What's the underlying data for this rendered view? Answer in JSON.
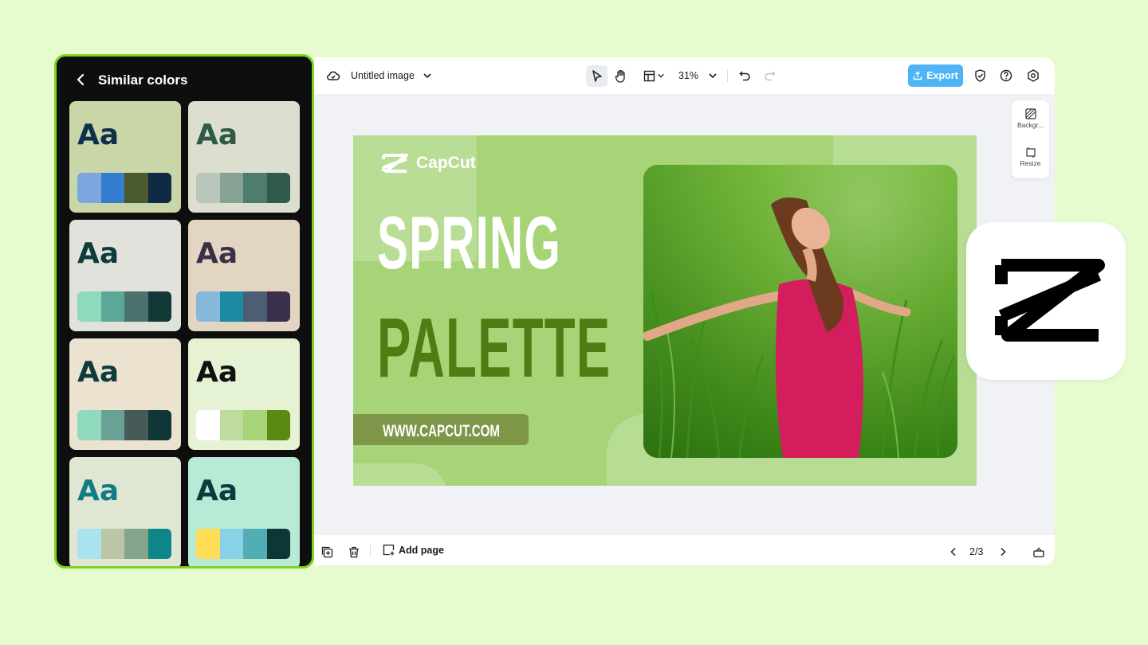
{
  "panel": {
    "title": "Similar colors",
    "cards": [
      {
        "sample": "Aa",
        "bg": "#c9d6a8",
        "text_color": "#0f2f4a",
        "swatches": [
          "#7ba6e0",
          "#357dcf",
          "#4b5a2e",
          "#0f2a44"
        ]
      },
      {
        "sample": "Aa",
        "bg": "#dcdfcf",
        "text_color": "#2f5a4a",
        "swatches": [
          "#b8c5bb",
          "#86a295",
          "#4d7d6b",
          "#2f5a4c"
        ]
      },
      {
        "sample": "Aa",
        "bg": "#e2e2dc",
        "text_color": "#0e3b3b",
        "swatches": [
          "#8fd9bd",
          "#5ca797",
          "#4c726d",
          "#123838"
        ]
      },
      {
        "sample": "Aa",
        "bg": "#e2d6c2",
        "text_color": "#3a3147",
        "swatches": [
          "#86b8d9",
          "#1b8aa3",
          "#4b5e74",
          "#3b3049"
        ]
      },
      {
        "sample": "Aa",
        "bg": "#ebe2cf",
        "text_color": "#0e3b3b",
        "swatches": [
          "#8fd9bd",
          "#6aa197",
          "#465a58",
          "#0e3636"
        ]
      },
      {
        "sample": "Aa",
        "bg": "#e6f2d4",
        "text_color": "#111111",
        "swatches": [
          "#ffffff",
          "#bfdc9f",
          "#a6d477",
          "#5a8a12"
        ]
      },
      {
        "sample": "Aa",
        "bg": "#dfe7d3",
        "text_color": "#0e7d86",
        "swatches": [
          "#a9e3ef",
          "#bcc6a7",
          "#85a58a",
          "#0e8589"
        ]
      },
      {
        "sample": "Aa",
        "bg": "#b8ead6",
        "text_color": "#0e3b3b",
        "swatches": [
          "#ffdd57",
          "#88d1e6",
          "#52aeb3",
          "#0e3636"
        ]
      }
    ]
  },
  "topbar": {
    "doc_title": "Untitled image",
    "zoom": "31%",
    "export_label": "Export"
  },
  "side_tools": {
    "background_label": "Backgr...",
    "resize_label": "Resize"
  },
  "bottombar": {
    "add_page_label": "Add page",
    "page_count": "2/3"
  },
  "design": {
    "brand": "CapCut",
    "headline_line1": "SPRING",
    "headline_line2": "PALETTE",
    "url": "WWW.CAPCUT.COM",
    "colors": {
      "bg": "#a6d477",
      "accent_dark": "#4f7d14",
      "pill": "#7e9647"
    }
  },
  "colors": {
    "page_bg": "#e6fccf",
    "panel_border": "#7ed321",
    "export_button": "#4fb4f5"
  },
  "icons": [
    "chevron-left-icon",
    "cloud-icon",
    "chevron-down-icon",
    "pointer-icon",
    "hand-icon",
    "layout-icon",
    "undo-icon",
    "redo-icon",
    "shield-icon",
    "help-icon",
    "settings-icon",
    "background-icon",
    "resize-icon",
    "duplicate-icon",
    "trash-icon",
    "add-page-icon",
    "prev-page-icon",
    "next-page-icon",
    "expand-icon",
    "capcut-logo-icon"
  ]
}
